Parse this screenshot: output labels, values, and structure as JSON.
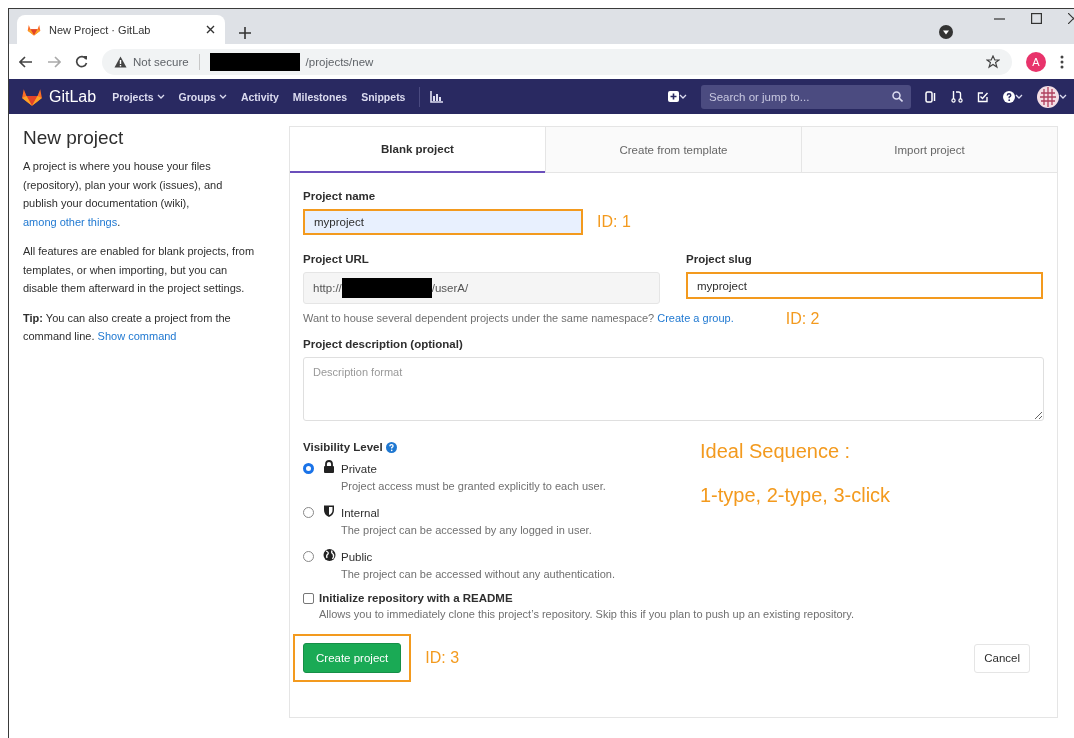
{
  "browser": {
    "tab_title": "New Project · GitLab",
    "security": "Not secure",
    "url_path": "/projects/new",
    "profile_initial": "A"
  },
  "navbar": {
    "brand": "GitLab",
    "items": [
      {
        "label": "Projects",
        "dropdown": true
      },
      {
        "label": "Groups",
        "dropdown": true
      },
      {
        "label": "Activity",
        "dropdown": false
      },
      {
        "label": "Milestones",
        "dropdown": false
      },
      {
        "label": "Snippets",
        "dropdown": false
      }
    ],
    "search": {
      "placeholder": "Search or jump to..."
    }
  },
  "sidebar": {
    "title": "New project",
    "paragraphs": [
      {
        "text": "A project is where you house your files (repository), plan your work (issues), and publish your documentation (wiki),",
        "link": "among other things",
        "after": "."
      },
      {
        "text": "All features are enabled for blank projects, from templates, or when importing, but you can disable them afterward in the project settings."
      },
      {
        "text": "**Tip:** You can also create a project from the command line.",
        "link": "Show command"
      }
    ]
  },
  "form": {
    "tabs": [
      {
        "label": "Blank project",
        "selected": true
      },
      {
        "label": "Create from template",
        "selected": false
      },
      {
        "label": "Import project",
        "selected": false
      }
    ],
    "project_name": {
      "label": "Project name",
      "value": "myproject",
      "annotation": "ID: 1"
    },
    "project_url": {
      "label": "Project URL",
      "prefix": "http://",
      "suffix": "/userA/"
    },
    "project_slug": {
      "label": "Project slug",
      "value": "myproject",
      "annotation": "ID: 2"
    },
    "namespace_hint": {
      "text": "Want to house several dependent projects under the same namespace?",
      "link": "Create a group."
    },
    "description": {
      "label": "Project description (optional)",
      "placeholder": "Description format"
    },
    "visibility": {
      "label": "Visibility Level",
      "options": [
        {
          "label": "Private",
          "description": "Project access must be granted explicitly to each user.",
          "kind": "lock",
          "selected": true
        },
        {
          "label": "Internal",
          "description": "The project can be accessed by any logged in user.",
          "kind": "shield",
          "selected": false
        },
        {
          "label": "Public",
          "description": "The project can be accessed without any authentication.",
          "kind": "globe",
          "selected": false
        }
      ]
    },
    "readme": {
      "label": "Initialize repository with a README",
      "description": "Allows you to immediately clone this project’s repository. Skip this if you plan to push up an existing repository.",
      "checked": false
    },
    "create_button": {
      "label": "Create project",
      "annotation": "ID: 3"
    },
    "cancel_button": {
      "label": "Cancel"
    }
  },
  "note": [
    "Ideal Sequence :",
    "1-type, 2-type, 3-click"
  ]
}
